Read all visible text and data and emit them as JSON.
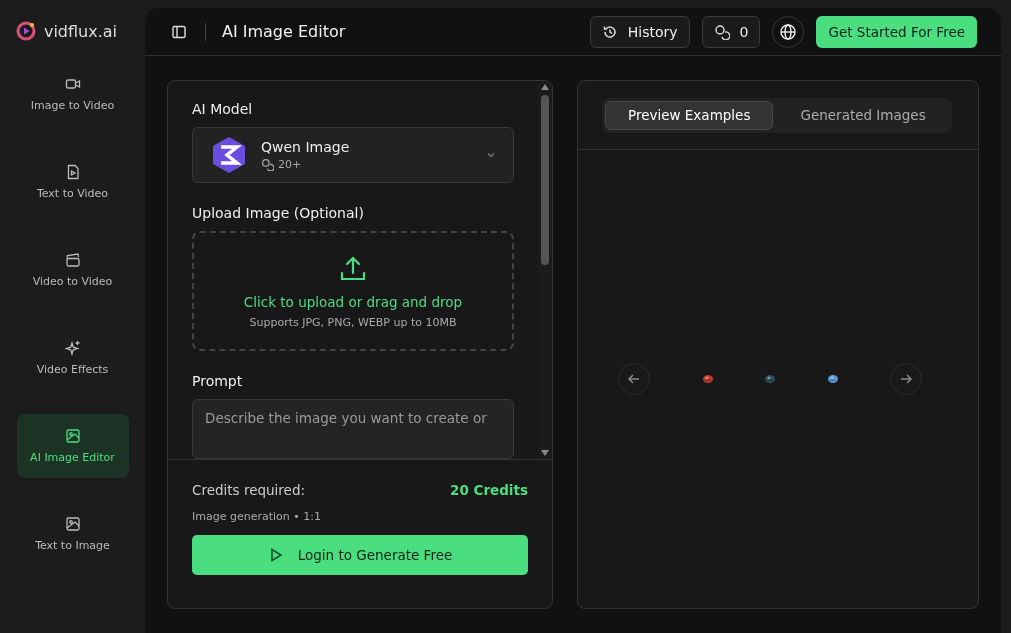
{
  "brand": {
    "name": "vidflux.ai"
  },
  "sidebar": {
    "items": [
      {
        "label": "Image to Video",
        "selected": false
      },
      {
        "label": "Text to Video",
        "selected": false
      },
      {
        "label": "Video to Video",
        "selected": false
      },
      {
        "label": "Video Effects",
        "selected": false
      },
      {
        "label": "AI Image Editor",
        "selected": true
      },
      {
        "label": "Text to Image",
        "selected": false
      }
    ]
  },
  "header": {
    "title": "AI Image Editor",
    "history": "History",
    "credits": "0",
    "cta": "Get Started For Free"
  },
  "form": {
    "model_label": "AI Model",
    "model": {
      "name": "Qwen Image",
      "cost": "20+"
    },
    "upload_label": "Upload Image (Optional)",
    "upload_title": "Click to upload or drag and drop",
    "upload_hint": "Supports JPG, PNG, WEBP up to 10MB",
    "prompt_label": "Prompt",
    "prompt_placeholder": "Describe the image you want to create or"
  },
  "footer": {
    "credits_label": "Credits required:",
    "credits_value": "20 Credits",
    "detail": "Image generation • 1:1",
    "button": "Login to Generate Free"
  },
  "preview": {
    "tabs": [
      {
        "label": "Preview Examples",
        "selected": true
      },
      {
        "label": "Generated Images",
        "selected": false
      }
    ]
  }
}
